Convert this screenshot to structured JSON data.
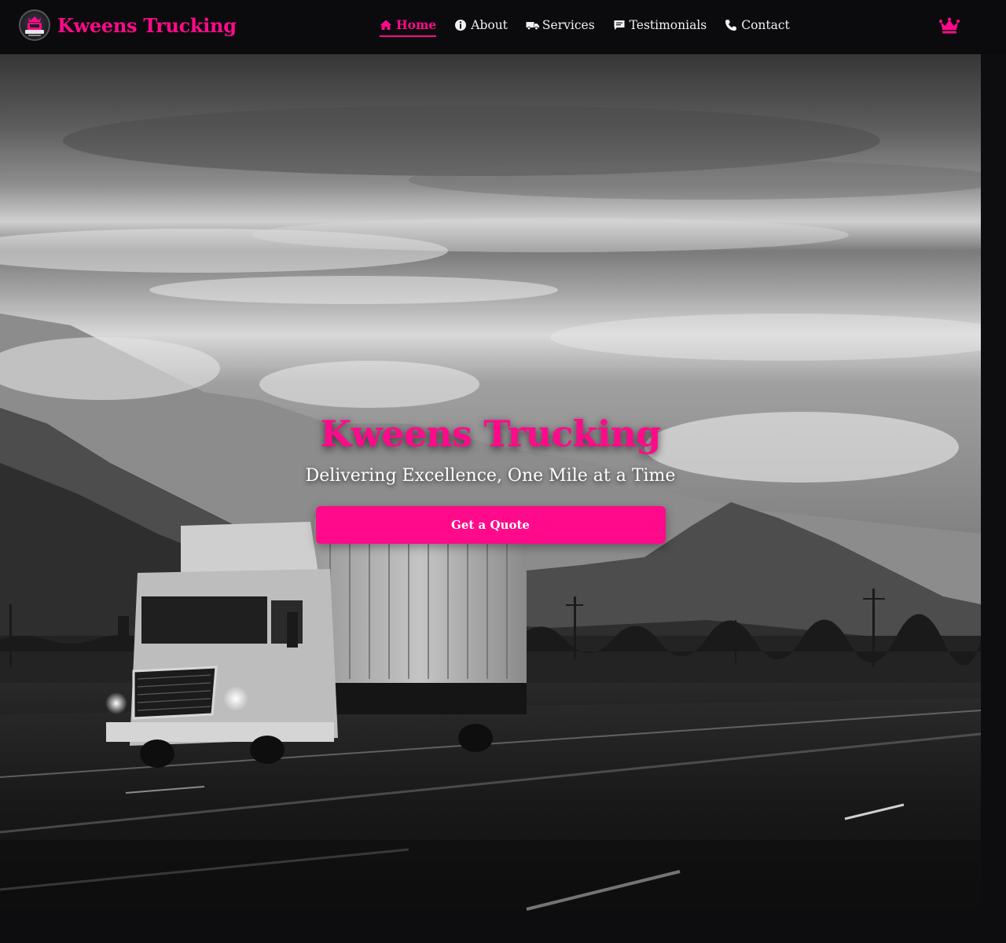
{
  "brand": {
    "name": "Kweens Trucking",
    "color": "#ff0a8b"
  },
  "nav": {
    "items": [
      {
        "label": "Home",
        "icon": "home-icon",
        "active": true
      },
      {
        "label": "About",
        "icon": "info-icon",
        "active": false
      },
      {
        "label": "Services",
        "icon": "truck-icon",
        "active": false
      },
      {
        "label": "Testimonials",
        "icon": "comment-icon",
        "active": false
      },
      {
        "label": "Contact",
        "icon": "phone-icon",
        "active": false
      }
    ],
    "right_icon": "crown-icon"
  },
  "hero": {
    "title": "Kweens Trucking",
    "subtitle": "Delivering Excellence, One Mile at a Time",
    "cta_label": "Get a Quote",
    "background": "black-and-white photo of a semi truck on a highway below misty mountains"
  },
  "colors": {
    "accent": "#ff0a8b",
    "nav_bg": "#0b0b0d",
    "page_bg": "#0d0d0f"
  }
}
